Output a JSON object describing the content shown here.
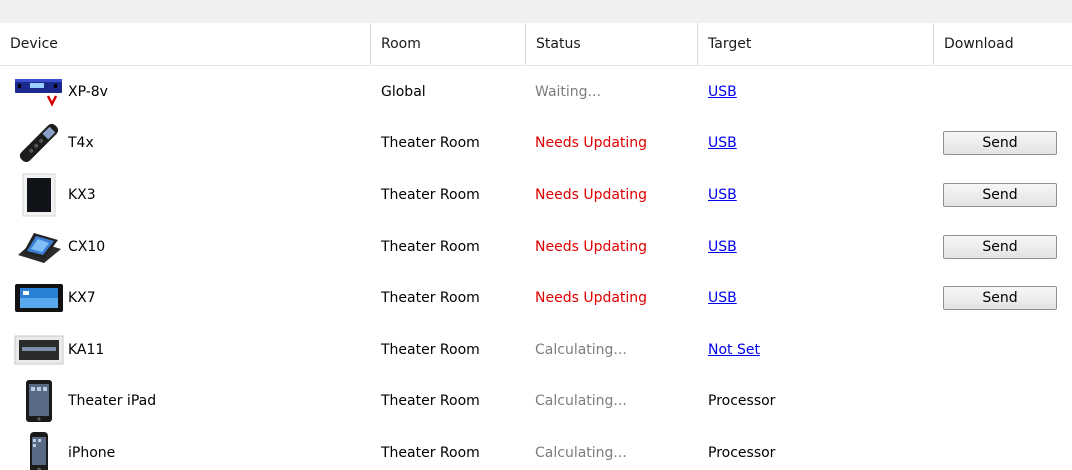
{
  "header": {
    "device": "Device",
    "room": "Room",
    "status": "Status",
    "target": "Target",
    "download": "Download"
  },
  "rows": [
    {
      "device": "XP-8v",
      "icon": "processor-device-icon",
      "room": "Global",
      "status": "Waiting...",
      "status_color": "gray",
      "target": "USB",
      "target_link": true,
      "download": null
    },
    {
      "device": "T4x",
      "icon": "remote-control-icon",
      "room": "Theater Room",
      "status": "Needs Updating",
      "status_color": "red",
      "target": "USB",
      "target_link": true,
      "download": "Send"
    },
    {
      "device": "KX3",
      "icon": "tablet-touchscreen-icon",
      "room": "Theater Room",
      "status": "Needs Updating",
      "status_color": "red",
      "target": "USB",
      "target_link": true,
      "download": "Send"
    },
    {
      "device": "CX10",
      "icon": "tabletop-touchscreen-icon",
      "room": "Theater Room",
      "status": "Needs Updating",
      "status_color": "red",
      "target": "USB",
      "target_link": true,
      "download": "Send"
    },
    {
      "device": "KX7",
      "icon": "wall-touchscreen-icon",
      "room": "Theater Room",
      "status": "Needs Updating",
      "status_color": "red",
      "target": "USB",
      "target_link": true,
      "download": "Send"
    },
    {
      "device": "KA11",
      "icon": "keypad-device-icon",
      "room": "Theater Room",
      "status": "Calculating...",
      "status_color": "gray",
      "target": "Not Set",
      "target_link": true,
      "download": null
    },
    {
      "device": "Theater iPad",
      "icon": "ipad-icon",
      "room": "Theater Room",
      "status": "Calculating...",
      "status_color": "gray",
      "target": "Processor",
      "target_link": false,
      "download": null
    },
    {
      "device": "iPhone",
      "icon": "iphone-icon",
      "room": "Theater Room",
      "status": "Calculating...",
      "status_color": "gray",
      "target": "Processor",
      "target_link": false,
      "download": null
    }
  ],
  "colors": {
    "needs_updating": "#e00000",
    "pending": "#7d7d7d",
    "link": "#0000ee"
  }
}
